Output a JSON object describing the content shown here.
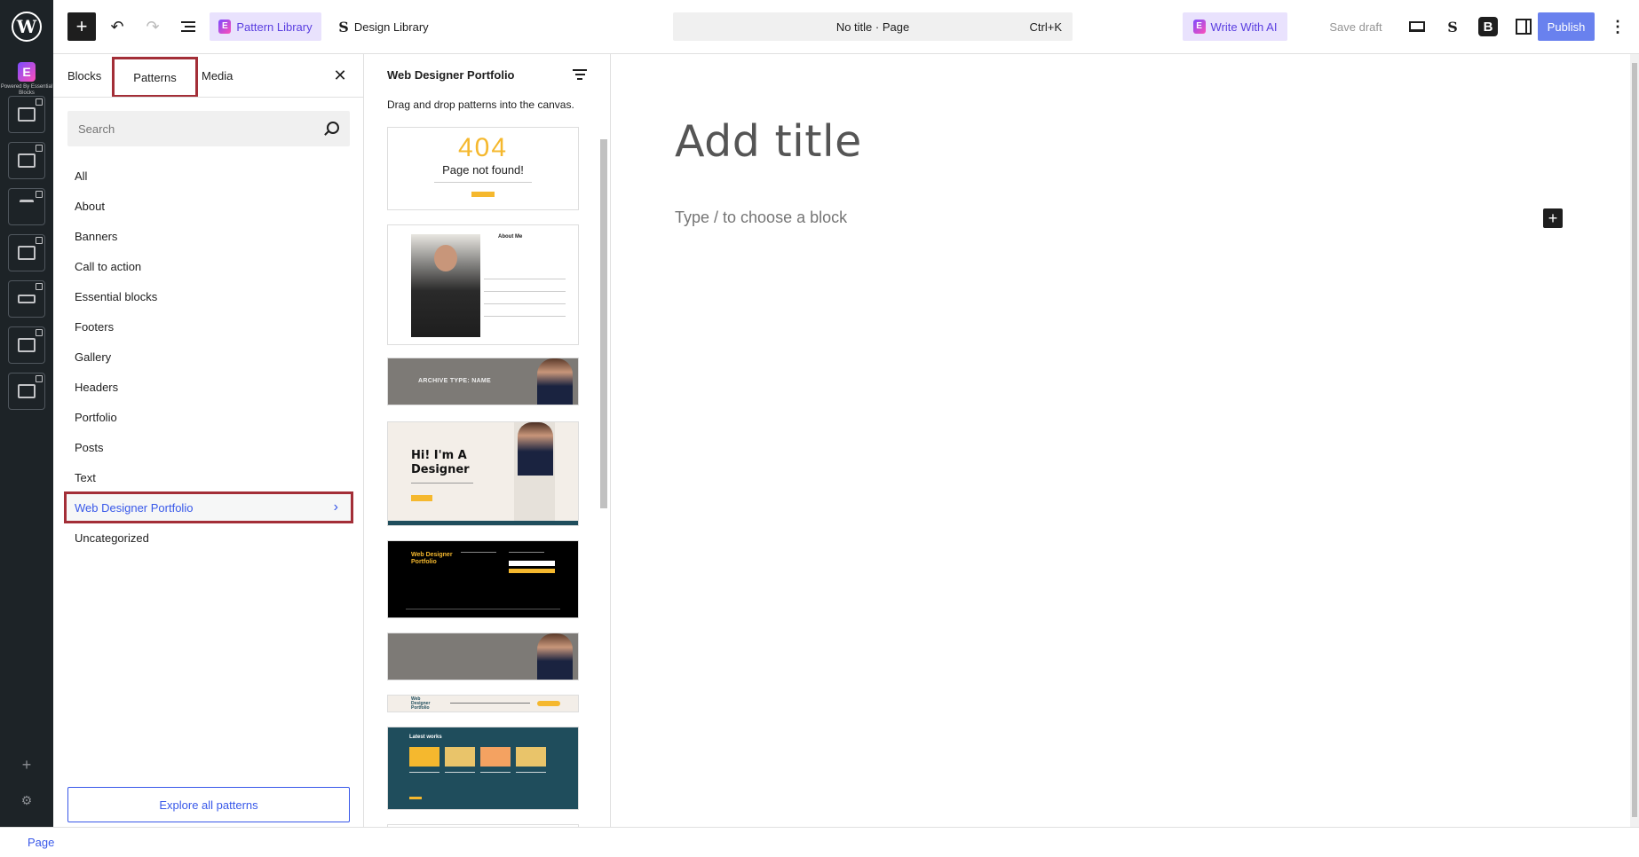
{
  "toolbar": {
    "pattern_library_label": "Pattern Library",
    "design_library_label": "Design Library",
    "document_title": "No title · Page",
    "command_shortcut": "Ctrl+K",
    "write_ai_label": "Write With AI",
    "save_draft_label": "Save draft",
    "publish_label": "Publish"
  },
  "admin_bar": {
    "brand_text": "Powered By Essential Blocks"
  },
  "inserter": {
    "tabs": [
      "Blocks",
      "Patterns",
      "Media"
    ],
    "active_tab": "Patterns",
    "search_placeholder": "Search",
    "categories": [
      "All",
      "About",
      "Banners",
      "Call to action",
      "Essential blocks",
      "Footers",
      "Gallery",
      "Headers",
      "Portfolio",
      "Posts",
      "Text",
      "Web Designer Portfolio",
      "Uncategorized"
    ],
    "active_category": "Web Designer Portfolio",
    "explore_label": "Explore all patterns"
  },
  "explorer": {
    "title": "Web Designer Portfolio",
    "description": "Drag and drop patterns into the canvas.",
    "thumbs": {
      "t404_number": "404",
      "t404_text": "Page not found!",
      "about_heading": "About Me",
      "archive_label": "ARCHIVE TYPE: NAME",
      "hero_text": "Hi! I'm A Designer",
      "footer_logo": "Web Designer Portfolio",
      "nav_logo": "Web Designer Portfolio",
      "works_heading": "Latest works"
    }
  },
  "canvas": {
    "title_placeholder": "Add title",
    "block_placeholder": "Type / to choose a block"
  },
  "footer": {
    "breadcrumb": "Page"
  },
  "colors": {
    "accent": "#3858e9",
    "highlight_border": "#a32e37",
    "ai_bg": "#e9e2fd",
    "ai_text": "#5a3ee0",
    "admin_bg": "#1d2327"
  }
}
